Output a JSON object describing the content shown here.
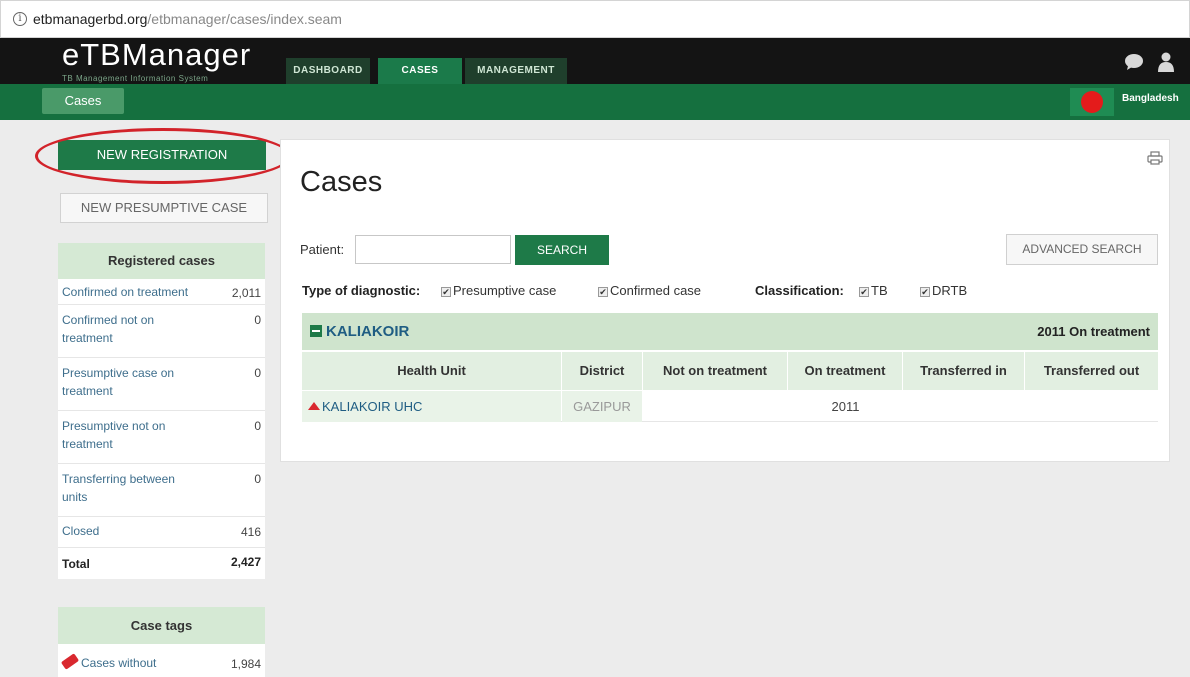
{
  "browser": {
    "url_domain": "etbmanagerbd.org",
    "url_path": "/etbmanager/cases/index.seam"
  },
  "header": {
    "logo": "eTBManager",
    "tagline": "TB Management Information System",
    "tabs": [
      {
        "label": "DASHBOARD",
        "active": false
      },
      {
        "label": "CASES",
        "active": true
      },
      {
        "label": "MANAGEMENT",
        "active": false
      }
    ],
    "breadcrumb": "Cases",
    "country": "Bangladesh",
    "icons": [
      "chat-icon",
      "user-icon"
    ]
  },
  "sidebar": {
    "new_registration": "NEW REGISTRATION",
    "new_presumptive": "NEW PRESUMPTIVE CASE",
    "registered_title": "Registered cases",
    "registered": [
      {
        "label": "Confirmed on treatment",
        "value": "2,011"
      },
      {
        "label": "Confirmed not on treatment",
        "value": "0"
      },
      {
        "label": "Presumptive case on treatment",
        "value": "0"
      },
      {
        "label": "Presumptive not on treatment",
        "value": "0"
      },
      {
        "label": "Transferring between units",
        "value": "0"
      },
      {
        "label": "Closed",
        "value": "416"
      },
      {
        "label": "Total",
        "value": "2,427"
      }
    ],
    "tags_title": "Case tags",
    "tags": [
      {
        "label": "Cases without",
        "value": "1,984"
      }
    ]
  },
  "main": {
    "title": "Cases",
    "patient_label": "Patient:",
    "patient_value": "",
    "search_button": "SEARCH",
    "advanced_button": "ADVANCED SEARCH",
    "diag_label": "Type of diagnostic:",
    "diag_options": [
      "Presumptive case",
      "Confirmed case"
    ],
    "class_label": "Classification:",
    "class_options": [
      "TB",
      "DRTB"
    ],
    "group": {
      "name": "KALIAKOIR",
      "summary": "2011 On treatment"
    },
    "columns": [
      "Health Unit",
      "District",
      "Not on treatment",
      "On treatment",
      "Transferred in",
      "Transferred out"
    ],
    "rows": [
      {
        "health_unit": "KALIAKOIR UHC",
        "district": "GAZIPUR",
        "not_on_treatment": "",
        "on_treatment": "2011",
        "transferred_in": "",
        "transferred_out": ""
      }
    ]
  },
  "colors": {
    "brand_green": "#1e7a48",
    "header_black": "#141414",
    "highlight_red": "#d2232a"
  }
}
